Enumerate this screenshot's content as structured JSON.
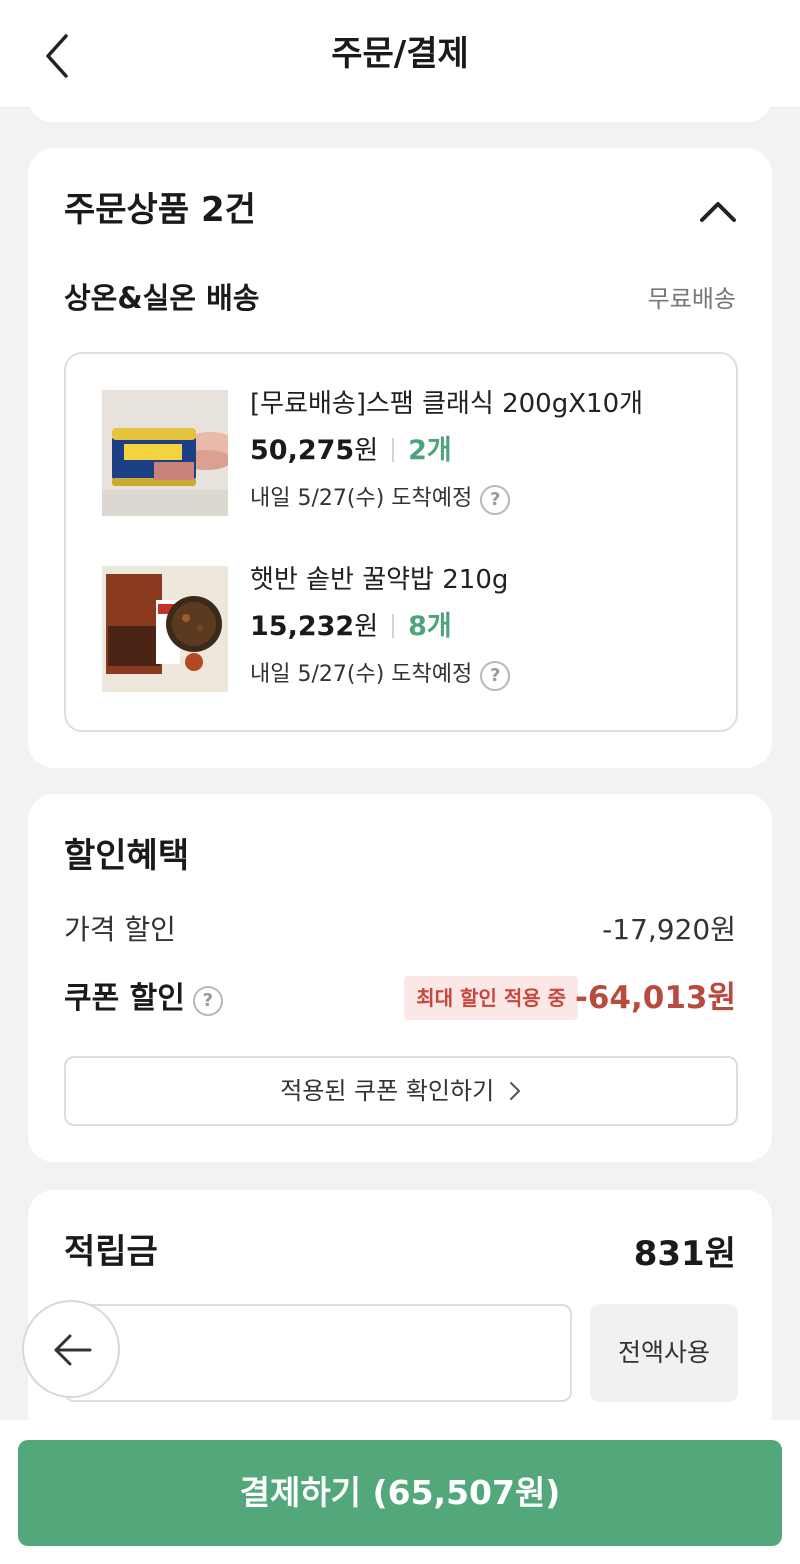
{
  "header": {
    "title": "주문/결제",
    "back_icon": "chevron-left-icon"
  },
  "order_items": {
    "title": "주문상품 2건",
    "collapse_icon": "chevron-up-icon",
    "shipping": {
      "name": "상온&실온 배송",
      "fee": "무료배송"
    },
    "items": [
      {
        "name": "[무료배송]스팸 클래식 200gX10개",
        "price": "50,275",
        "won": "원",
        "qty": "2개",
        "arrival": "내일 5/27(수) 도착예정",
        "help": "?"
      },
      {
        "name": "햇반 솥반 꿀약밥 210g",
        "price": "15,232",
        "won": "원",
        "qty": "8개",
        "arrival": "내일 5/27(수) 도착예정",
        "help": "?"
      }
    ]
  },
  "discount": {
    "title": "할인혜택",
    "price_discount_label": "가격 할인",
    "price_discount_value": "-17,920원",
    "coupon_label": "쿠폰 할인",
    "coupon_help": "?",
    "coupon_badge": "최대 할인 적용 중",
    "coupon_value": "-64,013원",
    "coupon_button": "적용된 쿠폰 확인하기"
  },
  "points": {
    "title": "적립금",
    "value": "831원",
    "input_value": "",
    "use_all": "전액사용"
  },
  "pay_button": "결제하기 (65,507원)",
  "colors": {
    "accent": "#52a87b",
    "qty": "#4fa378",
    "discount_red": "#b94a3e",
    "badge_bg": "#fbe8e6"
  }
}
